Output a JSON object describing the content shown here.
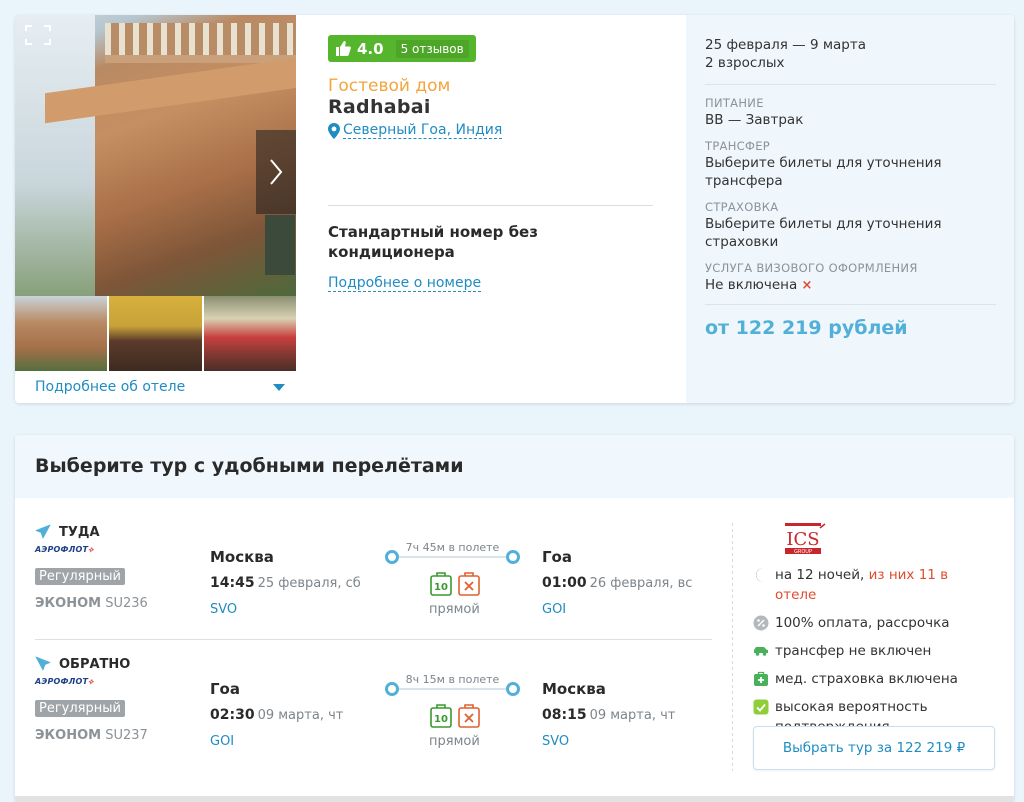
{
  "hotel": {
    "rating_score": "4.0",
    "reviews_label": "5 отзывов",
    "type": "Гостевой дом",
    "name": "Radhabai",
    "location": "Северный Гоа, Индия",
    "room_name": "Стандартный номер без кондиционера",
    "room_link": "Подробнее о номере",
    "more_hotel_link": "Подробнее об отеле"
  },
  "summary": {
    "dates": "25 февраля — 9 марта",
    "guests": "2 взрослых",
    "meal_label": "ПИТАНИЕ",
    "meal_value": "BB — Завтрак",
    "transfer_label": "ТРАНСФЕР",
    "transfer_value": "Выберите билеты для уточнения трансфера",
    "insurance_label": "СТРАХОВКА",
    "insurance_value": "Выберите билеты для уточнения страховки",
    "visa_label": "УСЛУГА ВИЗОВОГО ОФОРМЛЕНИЯ",
    "visa_value": "Не включена",
    "visa_status_icon": "×",
    "price": "от 122 219 рублей"
  },
  "flights": {
    "title": "Выберите тур с удобными перелётами",
    "outbound": {
      "label": "ТУДА",
      "airline": "АЭРОФЛОТ",
      "type_badge": "Регулярный",
      "class": "ЭКОНОМ",
      "flight_no": "SU236",
      "dep_city": "Москва",
      "dep_time": "14:45",
      "dep_date": "25 февраля, сб",
      "dep_code": "SVO",
      "duration": "7ч 45м в полете",
      "baggage_kg": "10",
      "stops": "прямой",
      "arr_city": "Гоа",
      "arr_time": "01:00",
      "arr_date": "26 февраля, вс",
      "arr_code": "GOI"
    },
    "return": {
      "label": "ОБРАТНО",
      "airline": "АЭРОФЛОТ",
      "type_badge": "Регулярный",
      "class": "ЭКОНОМ",
      "flight_no": "SU237",
      "dep_city": "Гоа",
      "dep_time": "02:30",
      "dep_date": "09 марта, чт",
      "dep_code": "GOI",
      "duration": "8ч 15м в полете",
      "baggage_kg": "10",
      "stops": "прямой",
      "arr_city": "Москва",
      "arr_time": "08:15",
      "arr_date": "09 марта, чт",
      "arr_code": "SVO"
    }
  },
  "tour": {
    "operator_logo": "ICS",
    "operator_logo_sub": "GROUP",
    "nights": "на 12 ночей,",
    "nights_hotel": "из них 11 в отеле",
    "payment": "100% оплата, рассрочка",
    "transfer": "трансфер не включен",
    "insurance": "мед. страховка включена",
    "confirmation": "высокая вероятность подтверждения",
    "select_button": "Выбрать тур за 122 219 ₽"
  },
  "colors": {
    "accent": "#1f8cc2",
    "rating_green": "#55b52d",
    "hotel_type_orange": "#f3a43c",
    "price_blue": "#52b0d8",
    "danger": "#e04c2f"
  }
}
